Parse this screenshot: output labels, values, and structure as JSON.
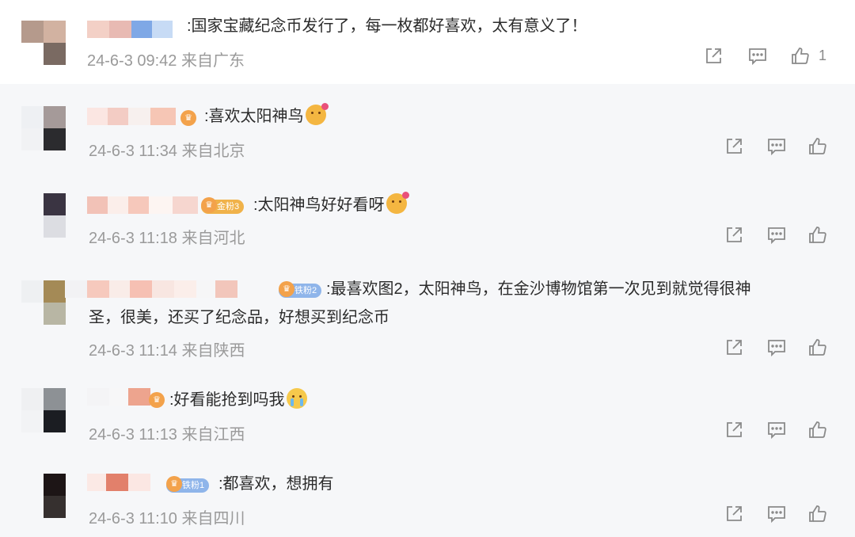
{
  "colors": {
    "text": "#2b2b2b",
    "meta": "#9a9a9a",
    "icon": "#8a8a8a",
    "reply_bg": "#f6f7f9",
    "badge_blue": "#8fb5ea",
    "badge_gold": "#f0b24a"
  },
  "comments": [
    {
      "text": ":国家宝藏纪念币发行了，每一枚都好喜欢，太有意义了！",
      "time": "24-6-3 09:42",
      "location": "来自广东",
      "like_count": "1"
    },
    {
      "text": ":喜欢太阳神鸟",
      "emoji": "heart-eyes-emoji",
      "time": "24-6-3 11:34",
      "location": "来自北京"
    },
    {
      "badge": "金粉3",
      "text": ":太阳神鸟好好看呀",
      "emoji": "love-emoji",
      "time": "24-6-3 11:18",
      "location": "来自河北"
    },
    {
      "badge": "铁粉2",
      "text_line1": ":最喜欢图2，太阳神鸟，在金沙博物馆第一次见到就觉得很神",
      "text_line2": "圣，很美，还买了纪念品，好想买到纪念币",
      "time": "24-6-3 11:14",
      "location": "来自陕西"
    },
    {
      "text": ":好看能抢到吗我",
      "emoji": "crying-emoji",
      "time": "24-6-3 11:13",
      "location": "来自江西"
    },
    {
      "badge": "铁粉1",
      "text": ":都喜欢，想拥有",
      "time": "24-6-3 11:10",
      "location": "来自四川"
    }
  ]
}
